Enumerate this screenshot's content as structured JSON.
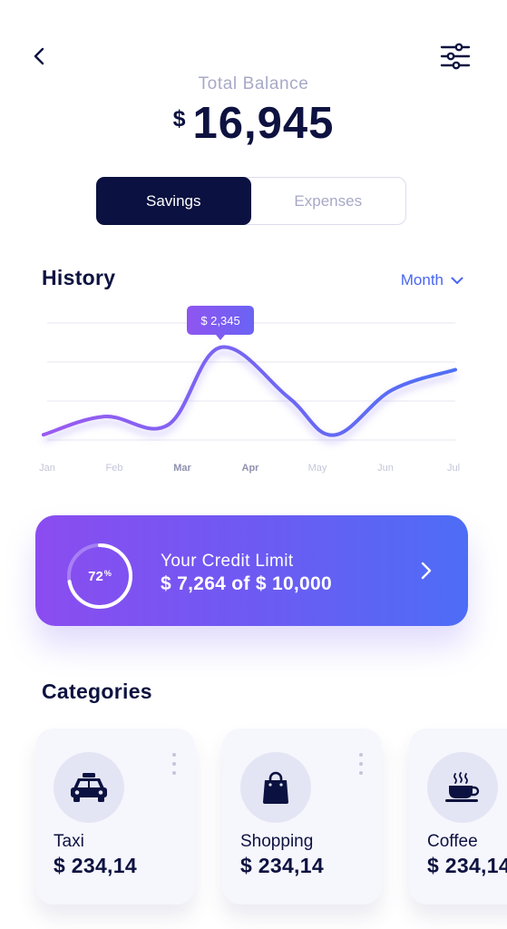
{
  "header": {
    "back_icon": "chevron-left-icon",
    "filter_icon": "sliders-icon"
  },
  "balance": {
    "label": "Total Balance",
    "currency": "$",
    "amount": "16,945"
  },
  "toggle": {
    "options": [
      "Savings",
      "Expenses"
    ],
    "selected": "Savings"
  },
  "history": {
    "title": "History",
    "period": "Month"
  },
  "chart_data": {
    "type": "line",
    "categories": [
      "Jan",
      "Feb",
      "Mar",
      "Apr",
      "May",
      "Jun",
      "Jul"
    ],
    "highlighted_categories": [
      "Mar",
      "Apr"
    ],
    "values": [
      0.09,
      0.56,
      0.34,
      2.345,
      0.08,
      0.04,
      1.77
    ],
    "tooltip": "$ 2,345",
    "grid": true,
    "colors": {
      "start": "#9a5bf0",
      "end": "#4f6ff6"
    }
  },
  "credit": {
    "percent": "72",
    "percent_unit": "%",
    "progress": 0.72,
    "label": "Your Credit Limit",
    "value": "$ 7,264 of $ 10,000"
  },
  "categories": {
    "title": "Categories",
    "items": [
      {
        "icon": "taxi-icon",
        "name": "Taxi",
        "amount": "$ 234,14"
      },
      {
        "icon": "shopping-bag-icon",
        "name": "Shopping",
        "amount": "$ 234,14"
      },
      {
        "icon": "coffee-cup-icon",
        "name": "Coffee",
        "amount": "$ 234,14"
      }
    ]
  },
  "colors": {
    "navy": "#0b1140",
    "accent_blue": "#4966f2",
    "muted": "#a7a9c6",
    "purple": "#8b4cf0"
  }
}
